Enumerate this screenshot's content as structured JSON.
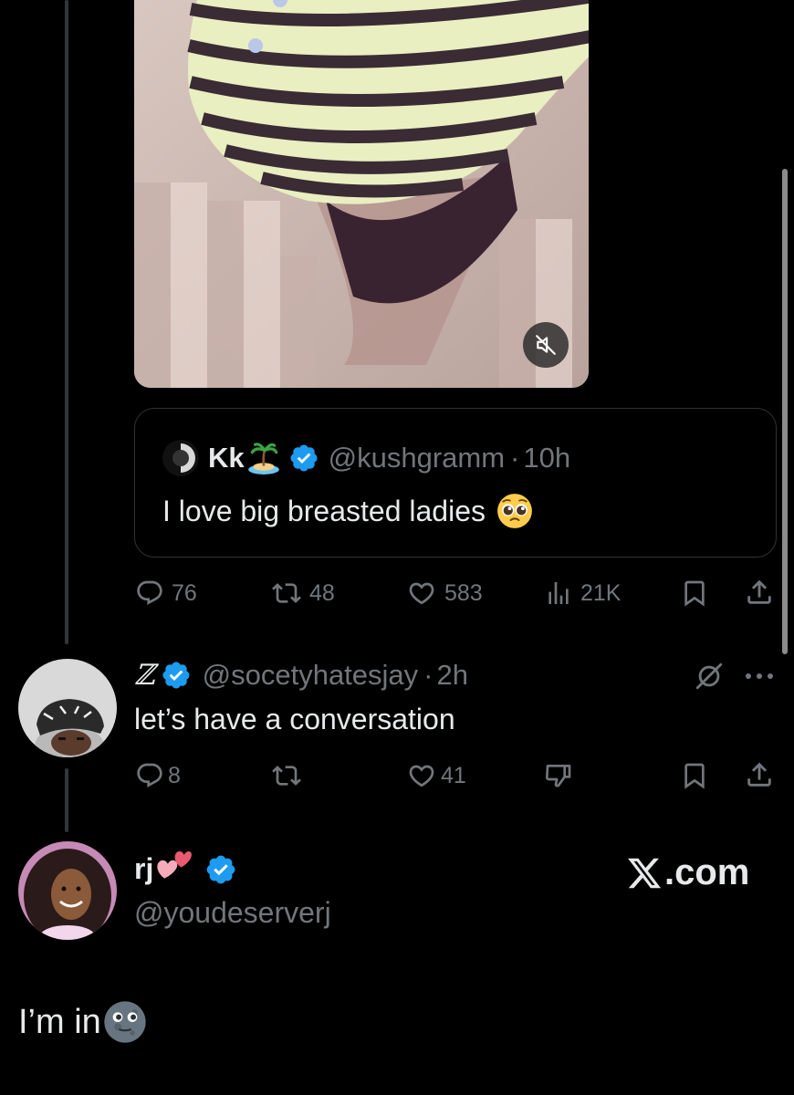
{
  "media": {
    "mute_icon": "volume-muted-icon"
  },
  "quoted_tweet": {
    "author_name": "Kk",
    "name_emoji": "desert-island-emoji",
    "verified": true,
    "handle": "@kushgramm",
    "separator": "·",
    "time": "10h",
    "text": "I love big breasted ladies",
    "text_emoji": "pleading-face-emoji"
  },
  "original_actions": {
    "replies": "76",
    "reposts": "48",
    "likes": "583",
    "views": "21K"
  },
  "reply_1": {
    "author_name": "ℤ",
    "verified": true,
    "handle": "@socetyhatesjay",
    "separator": "·",
    "time": "2h",
    "text": "let’s have a conversation",
    "actions": {
      "replies": "8",
      "reposts": "",
      "likes": "41"
    }
  },
  "reply_2": {
    "author_name": "rj",
    "name_emoji": "two-hearts-emoji",
    "verified": true,
    "handle": "@youdeserverj",
    "text": "I’m in",
    "text_emoji": "new-moon-face-emoji"
  },
  "watermark": {
    "logo": "x-logo",
    "text": ".com"
  },
  "colors": {
    "background": "#000000",
    "primary_text": "#e7e9ea",
    "secondary_text": "#71767b",
    "verified_blue": "#1d9bf0",
    "border": "#2f3336"
  }
}
